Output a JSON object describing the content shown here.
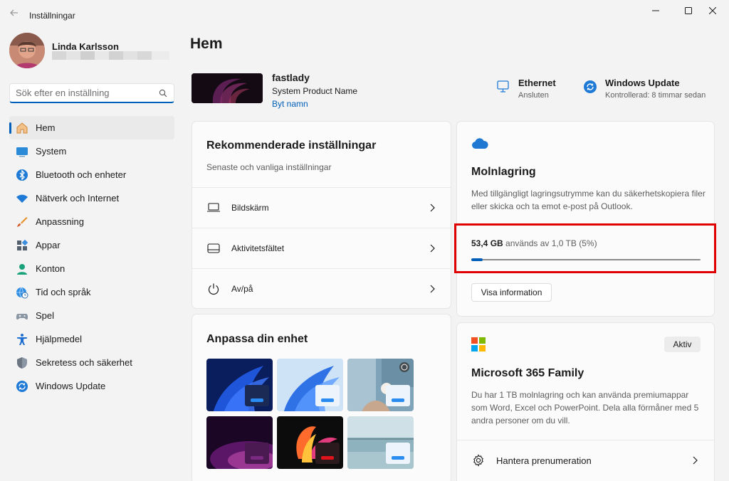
{
  "window": {
    "title": "Inställningar",
    "back_icon": "back-arrow-icon",
    "controls": [
      "minimize-icon",
      "maximize-icon",
      "close-icon"
    ]
  },
  "user": {
    "name": "Linda Karlsson"
  },
  "search": {
    "placeholder": "Sök efter en inställning",
    "value": ""
  },
  "sidebar": {
    "items": [
      {
        "label": "Hem",
        "icon": "home-icon",
        "active": true
      },
      {
        "label": "System",
        "icon": "system-icon"
      },
      {
        "label": "Bluetooth och enheter",
        "icon": "bluetooth-icon"
      },
      {
        "label": "Nätverk och Internet",
        "icon": "wifi-icon"
      },
      {
        "label": "Anpassning",
        "icon": "brush-icon"
      },
      {
        "label": "Appar",
        "icon": "apps-icon"
      },
      {
        "label": "Konton",
        "icon": "account-icon"
      },
      {
        "label": "Tid och språk",
        "icon": "globe-clock-icon"
      },
      {
        "label": "Spel",
        "icon": "gamepad-icon"
      },
      {
        "label": "Hjälpmedel",
        "icon": "accessibility-icon"
      },
      {
        "label": "Sekretess och säkerhet",
        "icon": "shield-icon"
      },
      {
        "label": "Windows Update",
        "icon": "update-icon"
      }
    ]
  },
  "main": {
    "title": "Hem",
    "device": {
      "name": "fastlady",
      "model": "System Product Name",
      "rename_link": "Byt namn"
    },
    "status": [
      {
        "title": "Ethernet",
        "subtitle": "Ansluten",
        "icon": "ethernet-icon"
      },
      {
        "title": "Windows Update",
        "subtitle": "Kontrollerad: 8 timmar sedan",
        "icon": "update-icon"
      }
    ],
    "recommended": {
      "title": "Rekommenderade inställningar",
      "subtitle": "Senaste och vanliga inställningar",
      "rows": [
        {
          "label": "Bildskärm",
          "icon": "display-icon"
        },
        {
          "label": "Aktivitetsfältet",
          "icon": "taskbar-icon"
        },
        {
          "label": "Av/på",
          "icon": "power-icon"
        }
      ]
    },
    "personalize": {
      "title": "Anpassa din enhet"
    },
    "cloud": {
      "icon": "onedrive-cloud-icon",
      "title": "Molnlagring",
      "description": "Med tillgängligt lagringsutrymme kan du säkerhetskopiera filer eller skicka och ta emot e-post på Outlook.",
      "used_amount": "53,4 GB",
      "used_text": "används av 1,0 TB (5%)",
      "used_fraction": 0.05,
      "button": "Visa information"
    },
    "m365": {
      "icon": "microsoft-logo-icon",
      "title": "Microsoft 365 Family",
      "badge": "Aktiv",
      "description": "Du har 1 TB molnlagring och kan använda premiumappar som Word, Excel och PowerPoint. Dela alla förmåner med 5 andra personer om du vill.",
      "manage_label": "Hantera prenumeration"
    }
  },
  "colors": {
    "accent": "#005fb8",
    "highlight": "#e00000",
    "background": "#f3f3f3"
  }
}
